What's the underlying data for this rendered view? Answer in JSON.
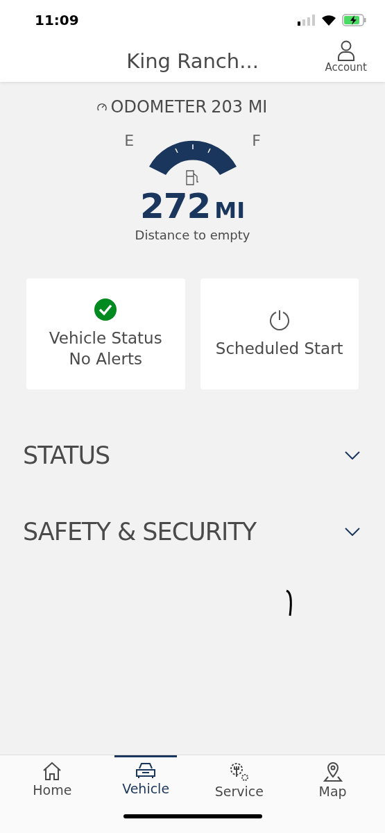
{
  "status_bar": {
    "time": "11:09"
  },
  "header": {
    "title": "King Ranch...",
    "account_label": "Account"
  },
  "odometer": {
    "label": "ODOMETER",
    "value": "203 MI"
  },
  "fuel": {
    "empty_label": "E",
    "full_label": "F",
    "distance": "272",
    "unit": "MI",
    "caption": "Distance to empty"
  },
  "cards": [
    {
      "kind": "status",
      "lines": [
        "Vehicle Status",
        "No Alerts"
      ]
    },
    {
      "kind": "schedule",
      "lines": [
        "Scheduled Start"
      ]
    }
  ],
  "sections": [
    {
      "title": "STATUS",
      "expanded": false
    },
    {
      "title": "SAFETY & SECURITY",
      "expanded": false
    }
  ],
  "tabs": [
    {
      "label": "Home",
      "kind": "home",
      "selected": false
    },
    {
      "label": "Vehicle",
      "kind": "vehicle",
      "selected": true
    },
    {
      "label": "Service",
      "kind": "service",
      "selected": false
    },
    {
      "label": "Map",
      "kind": "map",
      "selected": false
    }
  ]
}
